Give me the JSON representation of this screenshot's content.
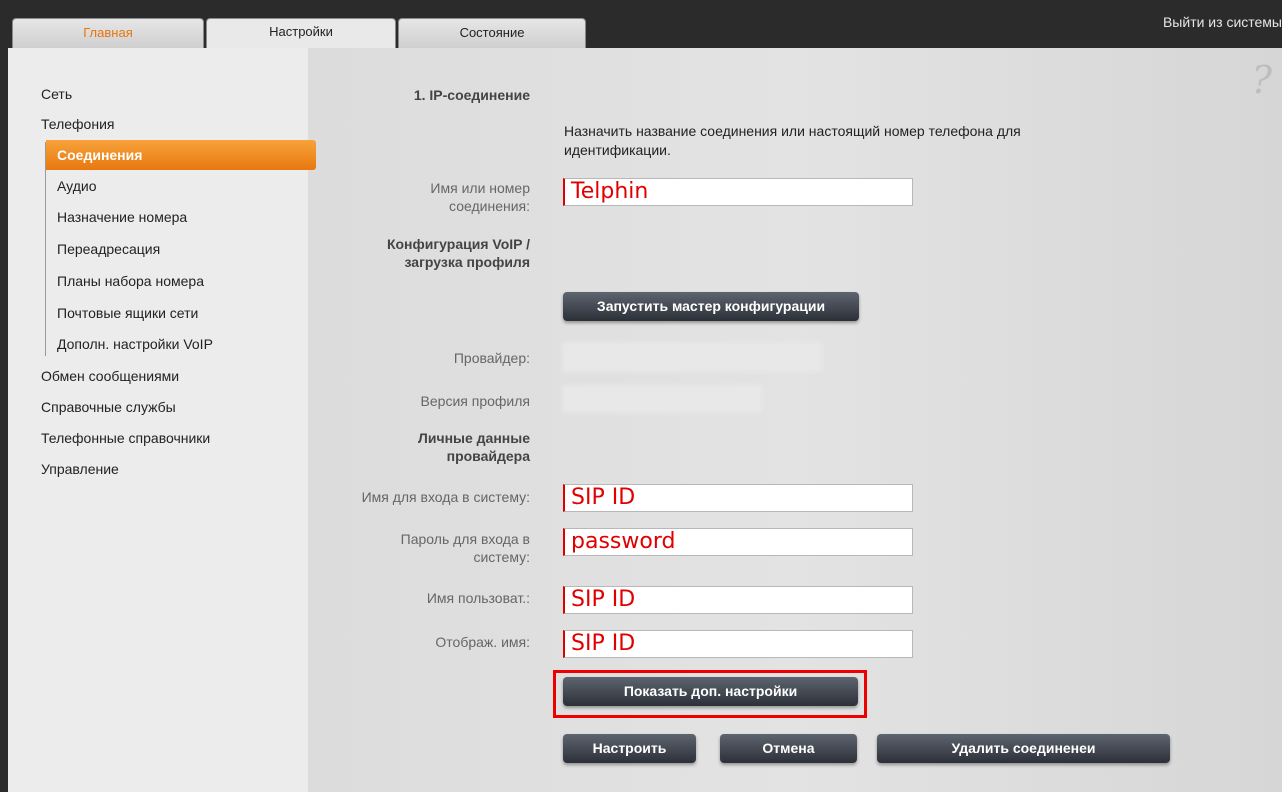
{
  "tabs": [
    {
      "label": "Главная"
    },
    {
      "label": "Настройки"
    },
    {
      "label": "Состояние"
    }
  ],
  "logout": "Выйти из системы",
  "sidebar": {
    "items": [
      {
        "label": "Сеть"
      },
      {
        "label": "Телефония"
      },
      {
        "label": "Соединения"
      },
      {
        "label": "Аудио"
      },
      {
        "label": "Назначение номера"
      },
      {
        "label": "Переадресация"
      },
      {
        "label": "Планы набора номера"
      },
      {
        "label": "Почтовые ящики сети"
      },
      {
        "label": "Дополн. настройки VoIP"
      },
      {
        "label": "Обмен сообщениями"
      },
      {
        "label": "Справочные службы"
      },
      {
        "label": "Телефонные справочники"
      },
      {
        "label": "Управление"
      }
    ]
  },
  "help": "?",
  "form": {
    "section_title": "1. IP-соединение",
    "hint": "Назначить название соединения или настоящий номер телефона для идентификации.",
    "conn_name_label": "Имя или номер соединения:",
    "conn_name_value": "Telphin",
    "voip_label": "Конфигурация VoIP / загрузка профиля",
    "wizard_button": "Запустить мастер конфигурации",
    "provider_label": "Провайдер:",
    "profile_version_label": "Версия профиля",
    "personal_label": "Личные данные провайдера",
    "login_label": "Имя для входа в систему:",
    "login_value": "SIP ID",
    "password_label": "Пароль для входа в систему:",
    "password_value": "password",
    "username_label": "Имя пользоват.:",
    "username_value": "SIP ID",
    "display_label": "Отображ. имя:",
    "display_value": "SIP ID",
    "advanced_button": "Показать доп. настройки",
    "setup_button": "Настроить",
    "cancel_button": "Отмена",
    "delete_button": "Удалить соединенеи"
  },
  "colors": {
    "accent": "#e8780f",
    "highlight": "#e00000"
  }
}
